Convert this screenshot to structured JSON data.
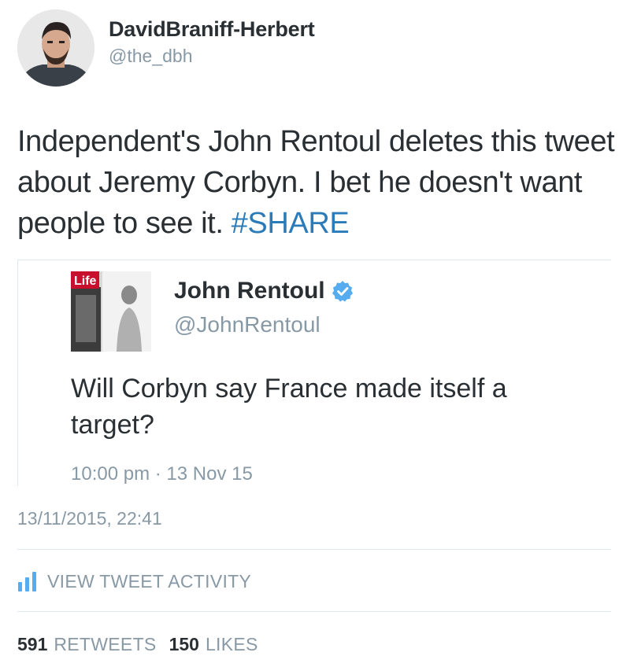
{
  "author": {
    "display_name": "DavidBraniff-Herbert",
    "handle": "@the_dbh",
    "avatar_icon": "user-avatar"
  },
  "tweet": {
    "text": "Independent's John Rentoul deletes this tweet about Jeremy Corbyn. I bet he doesn't want people to see it. ",
    "hashtag": "#SHARE",
    "timestamp": "13/11/2015, 22:41"
  },
  "quoted_tweet": {
    "display_name": "John Rentoul",
    "handle": "@JohnRentoul",
    "verified_icon": "verified-badge-icon",
    "avatar_text": "Life",
    "text": "Will Corbyn say France made itself a target?",
    "time": "10:00 pm · 13 Nov 15"
  },
  "activity": {
    "icon": "bar-chart-icon",
    "label": "VIEW TWEET ACTIVITY"
  },
  "stats": {
    "retweets_count": "591",
    "retweets_label": "RETWEETS",
    "likes_count": "150",
    "likes_label": "LIKES"
  },
  "colors": {
    "text": "#292f33",
    "muted": "#8899a6",
    "link": "#2b7bb9",
    "border": "#e1e8ed",
    "verified": "#55acee"
  }
}
